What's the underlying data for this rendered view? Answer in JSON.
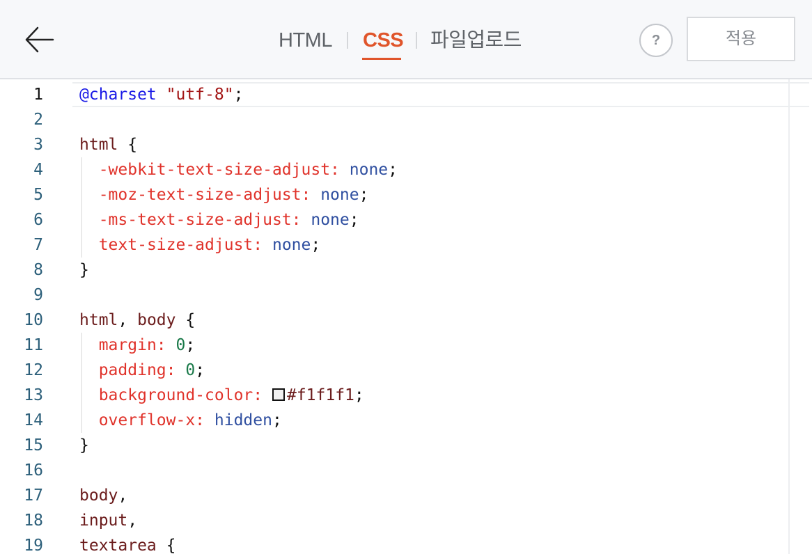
{
  "header": {
    "tabs": [
      {
        "id": "html",
        "label": "HTML",
        "active": false
      },
      {
        "id": "css",
        "label": "CSS",
        "active": true
      },
      {
        "id": "upload",
        "label": "파일업로드",
        "active": false
      }
    ],
    "help_label": "?",
    "apply_label": "적용",
    "back_icon": "arrow-left-icon"
  },
  "colors": {
    "accent": "#e0552b",
    "line_number": "#2c5f7a",
    "property": "#e0332b",
    "keyword_value": "#2f4fa0",
    "number": "#1b7a4a",
    "selector": "#6b1c1c",
    "at_rule": "#1a1ae6",
    "string": "#a31515",
    "swatch_color": "#f1f1f1"
  },
  "editor": {
    "active_line": 1,
    "lines": [
      {
        "n": "1",
        "tokens": [
          [
            "at",
            "@charset"
          ],
          [
            "plain",
            " "
          ],
          [
            "str",
            "\"utf-8\""
          ],
          [
            "punc",
            ";"
          ]
        ]
      },
      {
        "n": "2",
        "tokens": []
      },
      {
        "n": "3",
        "tokens": [
          [
            "sel",
            "html"
          ],
          [
            "punc",
            " {"
          ]
        ]
      },
      {
        "n": "4",
        "indent": true,
        "tokens": [
          [
            "prop",
            "-webkit-text-size-adjust:"
          ],
          [
            "plain",
            " "
          ],
          [
            "kw",
            "none"
          ],
          [
            "punc",
            ";"
          ]
        ]
      },
      {
        "n": "5",
        "indent": true,
        "tokens": [
          [
            "prop",
            "-moz-text-size-adjust:"
          ],
          [
            "plain",
            " "
          ],
          [
            "kw",
            "none"
          ],
          [
            "punc",
            ";"
          ]
        ]
      },
      {
        "n": "6",
        "indent": true,
        "tokens": [
          [
            "prop",
            "-ms-text-size-adjust:"
          ],
          [
            "plain",
            " "
          ],
          [
            "kw",
            "none"
          ],
          [
            "punc",
            ";"
          ]
        ]
      },
      {
        "n": "7",
        "indent": true,
        "tokens": [
          [
            "prop",
            "text-size-adjust:"
          ],
          [
            "plain",
            " "
          ],
          [
            "kw",
            "none"
          ],
          [
            "punc",
            ";"
          ]
        ]
      },
      {
        "n": "8",
        "tokens": [
          [
            "punc",
            "}"
          ]
        ]
      },
      {
        "n": "9",
        "tokens": []
      },
      {
        "n": "10",
        "tokens": [
          [
            "sel",
            "html"
          ],
          [
            "punc",
            ", "
          ],
          [
            "sel",
            "body"
          ],
          [
            "punc",
            " {"
          ]
        ]
      },
      {
        "n": "11",
        "indent": true,
        "tokens": [
          [
            "prop",
            "margin:"
          ],
          [
            "plain",
            " "
          ],
          [
            "num",
            "0"
          ],
          [
            "punc",
            ";"
          ]
        ]
      },
      {
        "n": "12",
        "indent": true,
        "tokens": [
          [
            "prop",
            "padding:"
          ],
          [
            "plain",
            " "
          ],
          [
            "num",
            "0"
          ],
          [
            "punc",
            ";"
          ]
        ]
      },
      {
        "n": "13",
        "indent": true,
        "tokens": [
          [
            "prop",
            "background-color:"
          ],
          [
            "plain",
            " "
          ],
          [
            "swatch",
            ""
          ],
          [
            "sel",
            "#f1f1f1"
          ],
          [
            "punc",
            ";"
          ]
        ]
      },
      {
        "n": "14",
        "indent": true,
        "tokens": [
          [
            "prop",
            "overflow-x:"
          ],
          [
            "plain",
            " "
          ],
          [
            "kw",
            "hidden"
          ],
          [
            "punc",
            ";"
          ]
        ]
      },
      {
        "n": "15",
        "tokens": [
          [
            "punc",
            "}"
          ]
        ]
      },
      {
        "n": "16",
        "tokens": []
      },
      {
        "n": "17",
        "tokens": [
          [
            "sel",
            "body"
          ],
          [
            "punc",
            ","
          ]
        ]
      },
      {
        "n": "18",
        "tokens": [
          [
            "sel",
            "input"
          ],
          [
            "punc",
            ","
          ]
        ]
      },
      {
        "n": "19",
        "tokens": [
          [
            "sel",
            "textarea"
          ],
          [
            "punc",
            " {"
          ]
        ]
      }
    ]
  }
}
